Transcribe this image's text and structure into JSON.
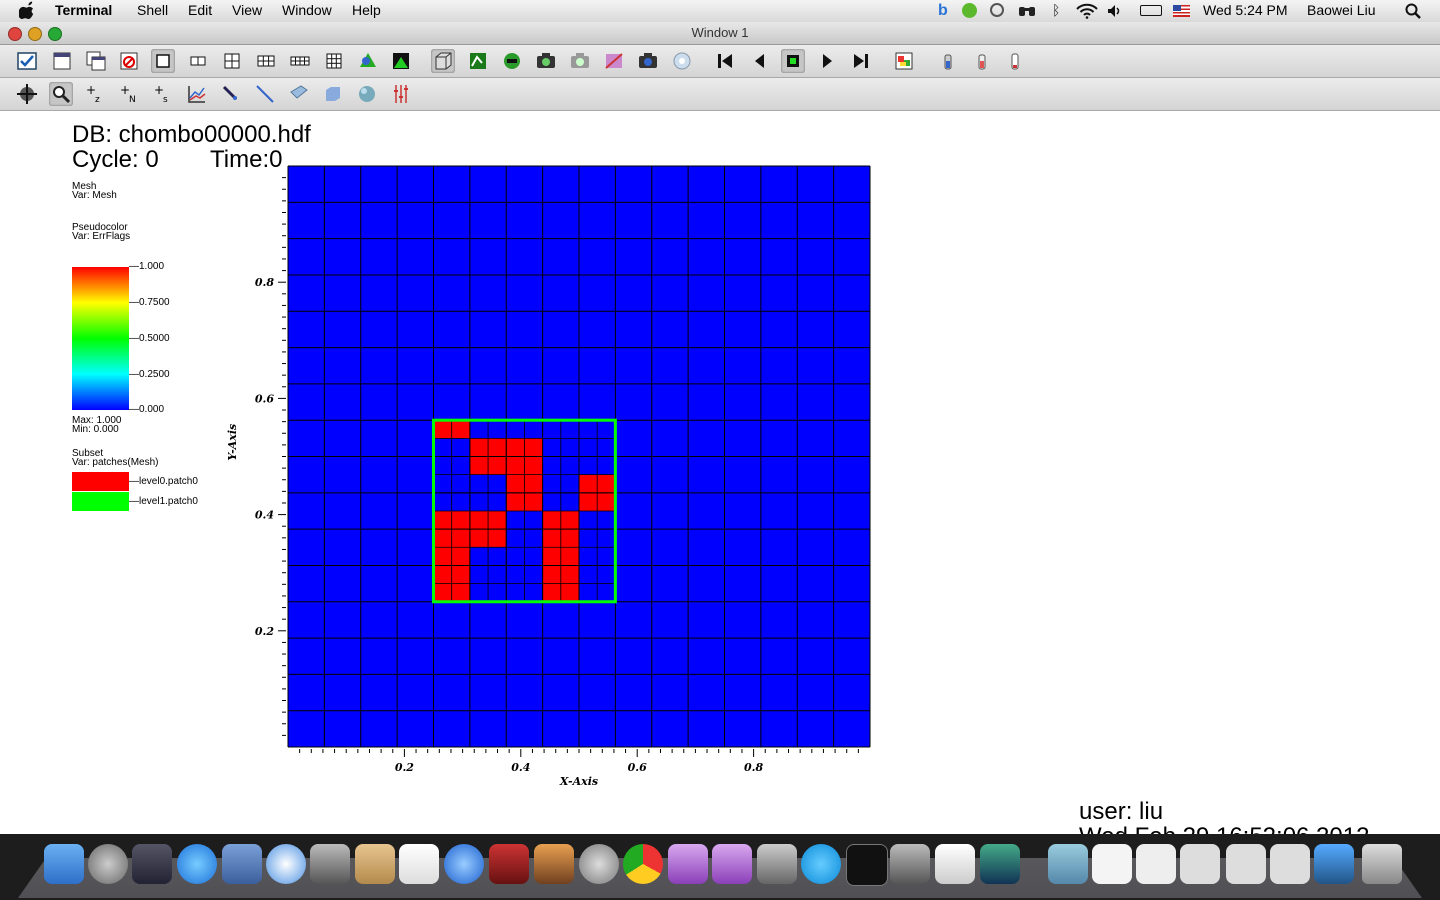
{
  "menubar": {
    "app_name": "Terminal",
    "menus": [
      "Shell",
      "Edit",
      "View",
      "Window",
      "Help"
    ],
    "clock": "Wed 5:24 PM",
    "user": "Baowei Liu"
  },
  "window": {
    "title": "Window 1"
  },
  "viz": {
    "db_label": "DB: chombo00000.hdf",
    "cycle_label": "Cycle: 0",
    "time_label": "Time:0",
    "mesh_legend": {
      "title": "Mesh",
      "var": "Var: Mesh"
    },
    "pseudocolor_legend": {
      "title": "Pseudocolor",
      "var": "Var: ErrFlags",
      "ticks": [
        "1.000",
        "0.7500",
        "0.5000",
        "0.2500",
        "0.000"
      ],
      "max": "Max:  1.000",
      "min": "Min:  0.000"
    },
    "subset_legend": {
      "title": "Subset",
      "var": "Var: patches(Mesh)",
      "entries": [
        {
          "label": "level0.patch0",
          "color": "#ff0000"
        },
        {
          "label": "level1.patch0",
          "color": "#00ff00"
        }
      ]
    },
    "user_label": "user: liu",
    "date_label": "Wed Feb 29 16:52:06 2012"
  },
  "chart_data": {
    "type": "heatmap",
    "xlabel": "X-Axis",
    "ylabel": "Y-Axis",
    "xlim": [
      0,
      1
    ],
    "ylim": [
      0,
      1
    ],
    "xticks": [
      "0.2",
      "0.4",
      "0.6",
      "0.8"
    ],
    "yticks": [
      "0.8",
      "0.6",
      "0.4",
      "0.2"
    ],
    "coarse_grid": 16,
    "background_value": 0.0,
    "colors": {
      "low": "#0000ff",
      "high": "#ff0000",
      "patch_outline": "#00ff00"
    },
    "fine_patch": {
      "x0": 0.25,
      "x1": 0.5625,
      "y0": 0.25,
      "y1": 0.5625,
      "fine_cells": 10
    },
    "flagged_cells_fine": [
      [
        0,
        0
      ],
      [
        1,
        0
      ],
      [
        2,
        1
      ],
      [
        3,
        1
      ],
      [
        4,
        1
      ],
      [
        5,
        1
      ],
      [
        2,
        2
      ],
      [
        3,
        2
      ],
      [
        4,
        2
      ],
      [
        5,
        2
      ],
      [
        4,
        3
      ],
      [
        5,
        3
      ],
      [
        8,
        3
      ],
      [
        9,
        3
      ],
      [
        4,
        4
      ],
      [
        5,
        4
      ],
      [
        8,
        4
      ],
      [
        9,
        4
      ],
      [
        0,
        5
      ],
      [
        1,
        5
      ],
      [
        2,
        5
      ],
      [
        3,
        5
      ],
      [
        6,
        5
      ],
      [
        7,
        5
      ],
      [
        0,
        6
      ],
      [
        1,
        6
      ],
      [
        2,
        6
      ],
      [
        3,
        6
      ],
      [
        6,
        6
      ],
      [
        7,
        6
      ],
      [
        0,
        7
      ],
      [
        1,
        7
      ],
      [
        6,
        7
      ],
      [
        7,
        7
      ],
      [
        0,
        8
      ],
      [
        1,
        8
      ],
      [
        6,
        8
      ],
      [
        7,
        8
      ],
      [
        0,
        9
      ],
      [
        1,
        9
      ],
      [
        6,
        9
      ],
      [
        7,
        9
      ]
    ]
  }
}
